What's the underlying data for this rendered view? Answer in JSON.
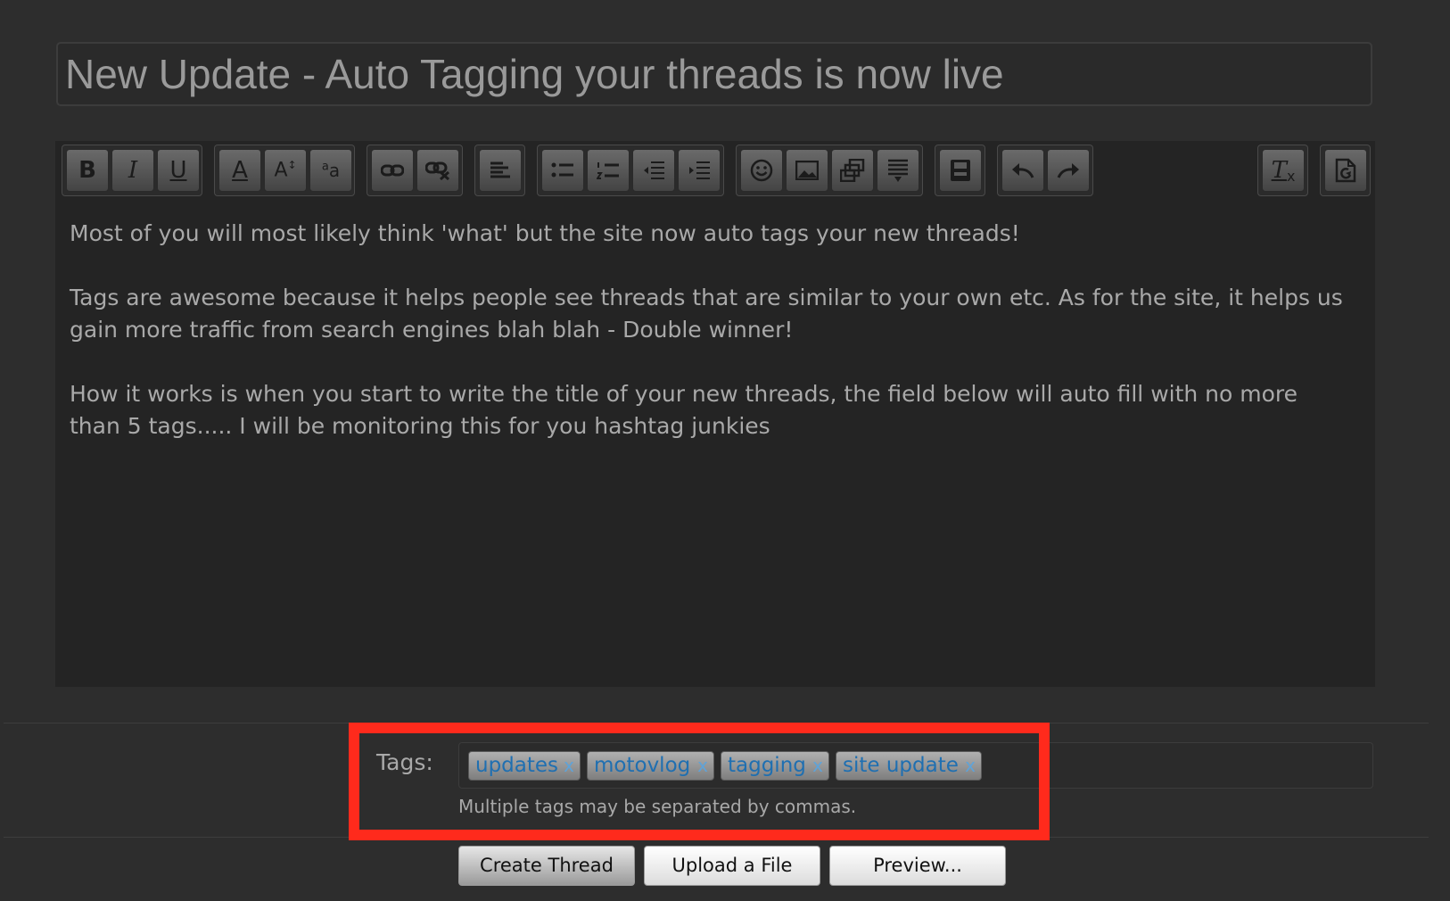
{
  "thread": {
    "title": "New Update - Auto Tagging your threads is now live"
  },
  "editor": {
    "toolbar_icons": [
      "bold-icon",
      "italic-icon",
      "underline-icon",
      "font-color-icon",
      "font-size-icon",
      "font-family-icon",
      "link-icon",
      "unlink-icon",
      "align-icon",
      "bullet-list-icon",
      "numbered-list-icon",
      "outdent-icon",
      "indent-icon",
      "smiley-icon",
      "image-icon",
      "media-icon",
      "quote-icon",
      "save-draft-icon",
      "undo-icon",
      "redo-icon",
      "remove-format-icon",
      "switch-mode-icon"
    ],
    "paragraphs": [
      "Most of you will most likely think 'what' but the site now auto tags your new threads!",
      "Tags are awesome because it helps people see threads that are similar to your own etc. As for the site, it helps us gain more traffic from search engines blah blah - Double winner!",
      "How it works is when you start to write the title of your new threads, the field below will auto fill with no more than 5 tags..... I will be monitoring this for you hashtag junkies"
    ]
  },
  "tags": {
    "label": "Tags:",
    "items": [
      "updates",
      "motovlog",
      "tagging",
      "site update"
    ],
    "remove_glyph": "x",
    "hint": "Multiple tags may be separated by commas."
  },
  "buttons": {
    "create": "Create Thread",
    "upload": "Upload a File",
    "preview": "Preview..."
  },
  "colors": {
    "background": "#2d2d2d",
    "editor_background": "#242424",
    "tag_text": "#1f6fb1",
    "highlight_box": "#ff2a1c"
  }
}
